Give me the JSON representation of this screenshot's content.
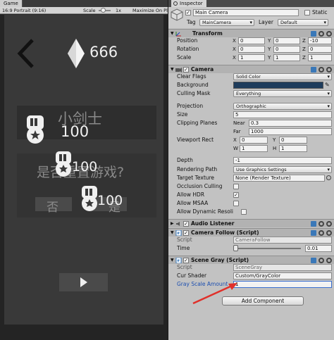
{
  "game": {
    "tab": "Game",
    "aspect": "16:9 Portrait (9:16)",
    "scale_label": "Scale",
    "scale_value": "1x",
    "maximize": "Maximize On Play",
    "diamond_count": "666",
    "player_name": "小剑士",
    "score_main": "100",
    "dialog_text": "是否重置游戏?",
    "score_overlap_1": "100",
    "score_overlap_2": "100",
    "no_button": "否",
    "yes_button": "是"
  },
  "inspector": {
    "tab": "Inspector",
    "object_name": "Main Camera",
    "static_label": "Static",
    "tag_label": "Tag",
    "tag_value": "MainCamera",
    "layer_label": "Layer",
    "layer_value": "Default",
    "transform": {
      "title": "Transform",
      "position_label": "Position",
      "position": {
        "x": "0",
        "y": "0",
        "z": "-10"
      },
      "rotation_label": "Rotation",
      "rotation": {
        "x": "0",
        "y": "0",
        "z": "0"
      },
      "scale_label": "Scale",
      "scale": {
        "x": "1",
        "y": "1",
        "z": "1"
      }
    },
    "camera": {
      "title": "Camera",
      "clear_flags_label": "Clear Flags",
      "clear_flags": "Solid Color",
      "background_label": "Background",
      "background_color": "#1e3c5c",
      "culling_mask_label": "Culling Mask",
      "culling_mask": "Everything",
      "projection_label": "Projection",
      "projection": "Orthographic",
      "size_label": "Size",
      "size": "5",
      "clipping_label": "Clipping Planes",
      "near_label": "Near",
      "near": "0.3",
      "far_label": "Far",
      "far": "1000",
      "viewport_label": "Viewport Rect",
      "vp_x": "0",
      "vp_y": "0",
      "vp_w": "1",
      "vp_h": "1",
      "depth_label": "Depth",
      "depth": "-1",
      "rendering_path_label": "Rendering Path",
      "rendering_path": "Use Graphics Settings",
      "target_texture_label": "Target Texture",
      "target_texture": "None (Render Texture)",
      "occlusion_label": "Occlusion Culling",
      "hdr_label": "Allow HDR",
      "msaa_label": "Allow MSAA",
      "dynres_label": "Allow Dynamic Resoli"
    },
    "audio_listener": {
      "title": "Audio Listener"
    },
    "camera_follow": {
      "title": "Camera Follow (Script)",
      "script_label": "Script",
      "script_value": "CameraFollow",
      "time_label": "Time",
      "time_value": "0.01"
    },
    "scene_gray": {
      "title": "Scene Gray (Script)",
      "script_label": "Script",
      "script_value": "SceneGray",
      "shader_label": "Cur Shader",
      "shader_value": "Custom/GrayColor",
      "amount_label": "Gray Scale Amount",
      "amount_value": "1"
    },
    "add_component": "Add Component"
  },
  "annotation": {
    "arrow_color": "#e0302a"
  }
}
